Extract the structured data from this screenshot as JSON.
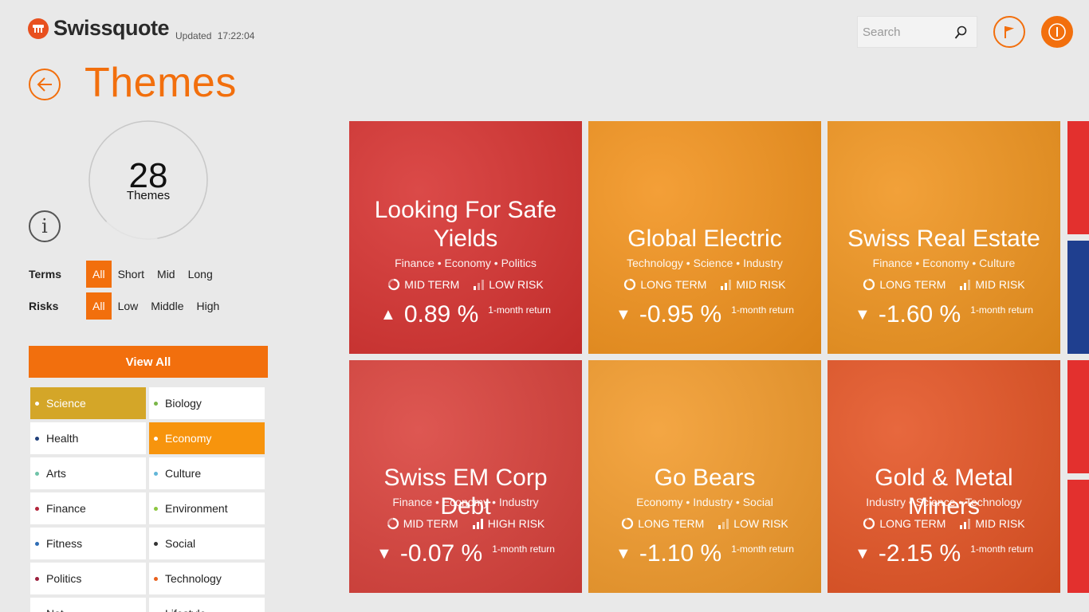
{
  "app": {
    "logo_text": "Swissquote",
    "updated_label": "Updated",
    "updated_time": "17:22:04"
  },
  "header": {
    "search_placeholder": "Search"
  },
  "page": {
    "title": "Themes"
  },
  "counter": {
    "count": "28",
    "label": "Themes",
    "progress": 0.85
  },
  "filters": {
    "terms": {
      "label": "Terms",
      "options": [
        "All",
        "Short",
        "Mid",
        "Long"
      ],
      "selected": "All"
    },
    "risks": {
      "label": "Risks",
      "options": [
        "All",
        "Low",
        "Middle",
        "High"
      ],
      "selected": "All"
    }
  },
  "view_all_label": "View All",
  "categories": [
    {
      "label": "Science",
      "dot": "#ffffff",
      "selected": true,
      "sel_color": "#d4a628"
    },
    {
      "label": "Biology",
      "dot": "#7ab648",
      "selected": false
    },
    {
      "label": "Health",
      "dot": "#1f3f7a",
      "selected": false
    },
    {
      "label": "Economy",
      "dot": "#ffffff",
      "selected": true,
      "sel_color": "#f7940d"
    },
    {
      "label": "Arts",
      "dot": "#6fc3a8",
      "selected": false
    },
    {
      "label": "Culture",
      "dot": "#62b6d8",
      "selected": false
    },
    {
      "label": "Finance",
      "dot": "#b3243a",
      "selected": false
    },
    {
      "label": "Environment",
      "dot": "#8cc63f",
      "selected": false
    },
    {
      "label": "Fitness",
      "dot": "#2f6db5",
      "selected": false
    },
    {
      "label": "Social",
      "dot": "#333333",
      "selected": false
    },
    {
      "label": "Politics",
      "dot": "#9b1f3c",
      "selected": false
    },
    {
      "label": "Technology",
      "dot": "#e8601c",
      "selected": false
    },
    {
      "label": "Nat",
      "dot": "#7ab648",
      "selected": false
    },
    {
      "label": "Lifestyle",
      "dot": "#c24a8e",
      "selected": false
    }
  ],
  "tiles": [
    {
      "title": "Looking For Safe Yields",
      "tags": "Finance • Economy • Politics",
      "term": "MID TERM",
      "risk": "LOW RISK",
      "direction": "up",
      "return": "0.89 %",
      "return_label": "1-month return",
      "color": "#d6312f",
      "risk_level": 1,
      "term_level": 2
    },
    {
      "title": "Global Electric",
      "tags": "Technology • Science • Industry",
      "term": "LONG TERM",
      "risk": "MID RISK",
      "direction": "down",
      "return": "-0.95 %",
      "return_label": "1-month return",
      "color": "#f2921c",
      "risk_level": 2,
      "term_level": 3
    },
    {
      "title": "Swiss Real Estate",
      "tags": "Finance • Economy • Culture",
      "term": "LONG TERM",
      "risk": "MID RISK",
      "direction": "down",
      "return": "-1.60 %",
      "return_label": "1-month return",
      "color": "#f0941e",
      "risk_level": 2,
      "term_level": 3
    },
    {
      "title": "Swiss EM Corp Debt",
      "tags": "Finance • Economy • Industry",
      "term": "MID TERM",
      "risk": "HIGH RISK",
      "direction": "down",
      "return": "-0.07 %",
      "return_label": "1-month return",
      "color": "#d9403a",
      "risk_level": 3,
      "term_level": 2
    },
    {
      "title": "Go Bears",
      "tags": "Economy • Industry • Social",
      "term": "LONG TERM",
      "risk": "LOW RISK",
      "direction": "down",
      "return": "-1.10 %",
      "return_label": "1-month return",
      "color": "#f29a2a",
      "risk_level": 1,
      "term_level": 3
    },
    {
      "title": "Gold & Metal Miners",
      "tags": "Industry • Science • Technology",
      "term": "LONG TERM",
      "risk": "MID RISK",
      "direction": "down",
      "return": "-2.15 %",
      "return_label": "1-month return",
      "color": "#e45323",
      "risk_level": 2,
      "term_level": 3
    }
  ],
  "edge_tiles": [
    "#e3302e",
    "#1f3f8f",
    "#e3302e"
  ]
}
